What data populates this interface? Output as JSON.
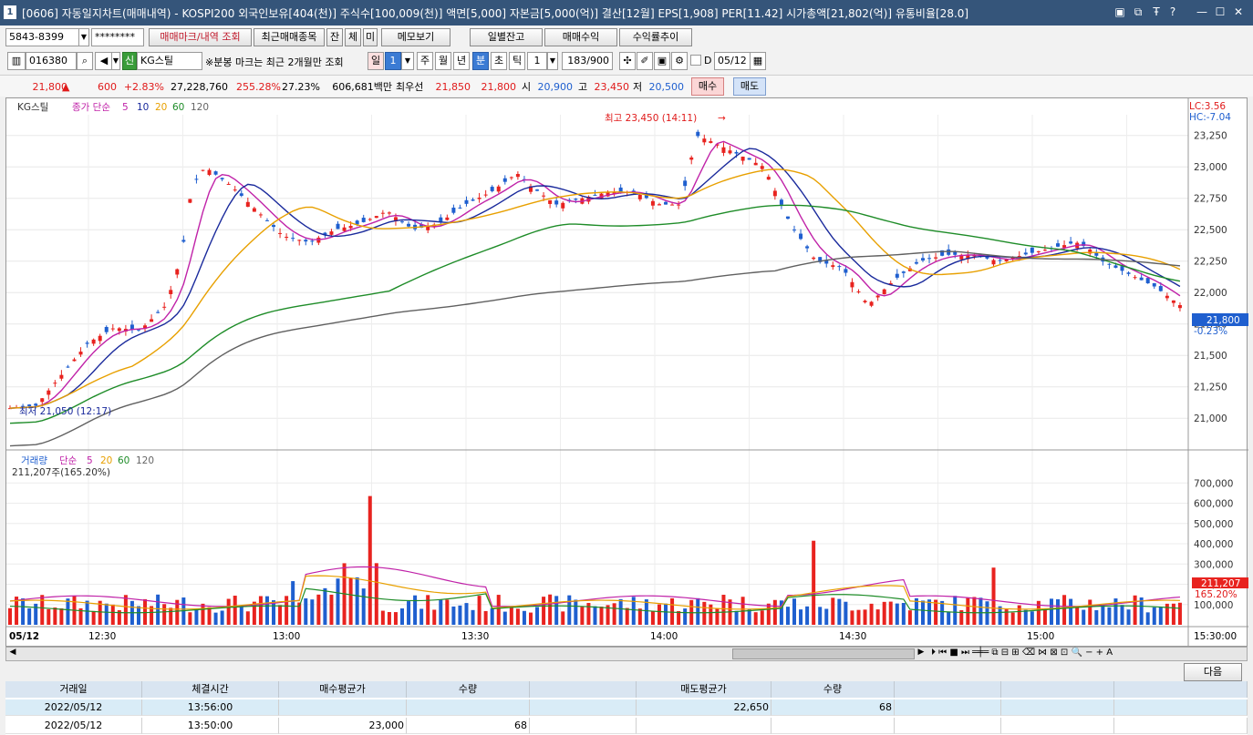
{
  "window": {
    "number": "1",
    "title": "[0606] 자동일지차트(매매내역) - KOSPI200 외국인보유[404(천)] 주식수[100,009(천)] 액면[5,000] 자본금[5,000(억)] 결산[12월] EPS[1,908] PER[11.42] 시가총액[21,802(억)] 유통비율[28.0]",
    "controls": [
      "▣",
      "⧉",
      "Ŧ",
      "?",
      "—",
      "☐",
      "✕"
    ]
  },
  "toolbar1": {
    "account": "5843-8399",
    "password": "********",
    "buttons": [
      "매매마크/내역 조회",
      "최근매매종목",
      "잔",
      "체",
      "미",
      "메모보기"
    ],
    "right_buttons": [
      "일별잔고",
      "매매수익",
      "수익률추이"
    ]
  },
  "toolbar2": {
    "code": "016380",
    "name": "KG스틸",
    "notice": "※분봉 마크는 최근 2개월만 조회",
    "period_buttons": [
      "일",
      "1",
      "주",
      "월",
      "년",
      "분",
      "초",
      "틱"
    ],
    "tick_value": "1",
    "count": "183/900",
    "date_checkbox": "D",
    "date": "05/12"
  },
  "quote": {
    "price": "21,800",
    "arrow": "▲",
    "change": "600",
    "change_pct": "+2.83%",
    "volume": "27,228,760",
    "vol_ratio": "255.28%",
    "turnover": "27.23%",
    "amount": "606,681백만",
    "best_label": "최우선",
    "ask": "21,850",
    "bid": "21,800",
    "open_label": "시",
    "open": "20,900",
    "high_label": "고",
    "high": "23,450",
    "low_label": "저",
    "low": "20,500",
    "buy": "매수",
    "sell": "매도"
  },
  "price_panel": {
    "legend_name": "KG스틸",
    "legend_ma": "종가 단순",
    "ma_periods": [
      "5",
      "10",
      "20",
      "60",
      "120"
    ],
    "high_annotation": "최고 23,450 (14:11)",
    "low_annotation": "최저 21,050 (12:17)",
    "lc": "LC:3.56",
    "hc": "HC:-7.04",
    "y_ticks": [
      "23,250",
      "23,000",
      "22,750",
      "22,500",
      "22,250",
      "22,000",
      "21,750",
      "21,500",
      "21,250",
      "21,000"
    ],
    "current_price": "21,800",
    "current_pct": "-0.23%"
  },
  "volume_panel": {
    "legend_name": "거래량",
    "legend_ma": "단순",
    "ma_periods": [
      "5",
      "20",
      "60",
      "120"
    ],
    "summary": "211,207주(165.20%)",
    "y_ticks": [
      "700,000",
      "600,000",
      "500,000",
      "400,000",
      "300,000",
      "200,000",
      "100,000"
    ],
    "current_volume": "211,207",
    "current_pct": "165.20%"
  },
  "x_axis": {
    "date": "05/12",
    "labels": [
      "12:30",
      "13:00",
      "13:30",
      "14:00",
      "14:30",
      "15:00"
    ],
    "last": "15:30:00"
  },
  "chart_data": {
    "type": "candlestick",
    "ylim": [
      20900,
      23400
    ],
    "colors": {
      "up": "#e8231f",
      "down": "#1f5fcf",
      "ma5": "#c022a8",
      "ma10": "#1a2a9c",
      "ma20": "#e8a000",
      "ma60": "#1e8c28",
      "ma120": "#606060"
    }
  },
  "table": {
    "next": "다음",
    "headers": [
      "거래일",
      "체결시간",
      "매수평균가",
      "수량",
      "",
      "매도평균가",
      "수량",
      "",
      "",
      ""
    ],
    "rows": [
      [
        "2022/05/12",
        "13:56:00",
        "",
        "",
        "",
        "22,650",
        "68",
        "",
        "",
        ""
      ],
      [
        "2022/05/12",
        "13:50:00",
        "23,000",
        "68",
        "",
        "",
        "",
        "",
        "",
        ""
      ]
    ]
  }
}
